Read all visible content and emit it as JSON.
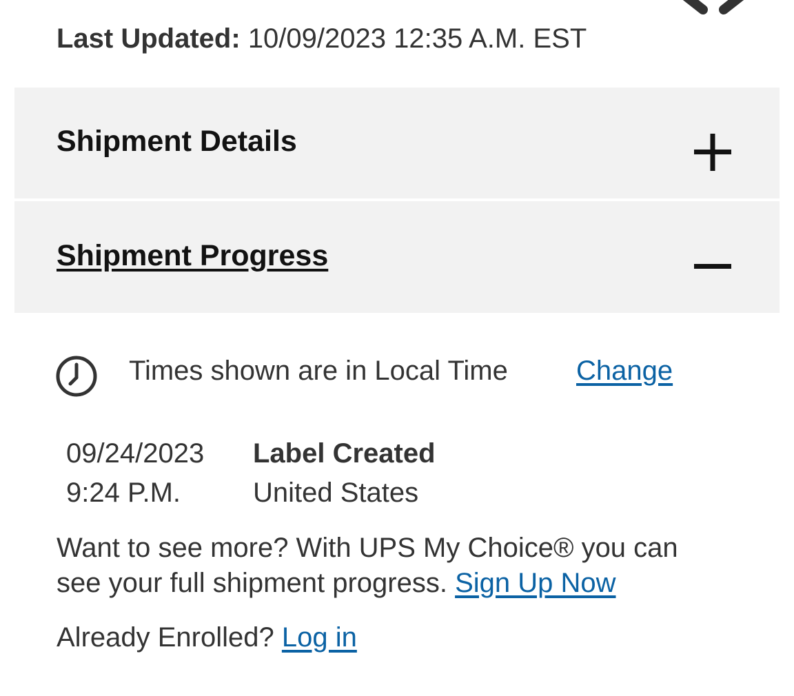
{
  "header": {
    "last_updated_label": "Last Updated:",
    "last_updated_value": "10/09/2023 12:35 A.M. EST"
  },
  "accordions": [
    {
      "title": "Shipment Details",
      "state": "collapsed",
      "icon": "plus-icon"
    },
    {
      "title": "Shipment Progress",
      "state": "expanded",
      "icon": "minus-icon"
    }
  ],
  "timezone": {
    "icon": "clock-icon",
    "text": "Times shown are in Local Time",
    "change_label": "Change"
  },
  "events": [
    {
      "date": "09/24/2023",
      "time": "9:24 P.M.",
      "status": "Label Created",
      "location": "United States"
    }
  ],
  "promo": {
    "line1": "Want to see more? With UPS My Choice® you can",
    "line2": "see your full shipment progress.",
    "signup_label": "Sign Up Now",
    "enrolled_text": "Already Enrolled?",
    "login_label": "Log in"
  },
  "colors": {
    "link": "#0b62a4",
    "accordion_bg": "#f2f2f2",
    "text": "#333333"
  }
}
